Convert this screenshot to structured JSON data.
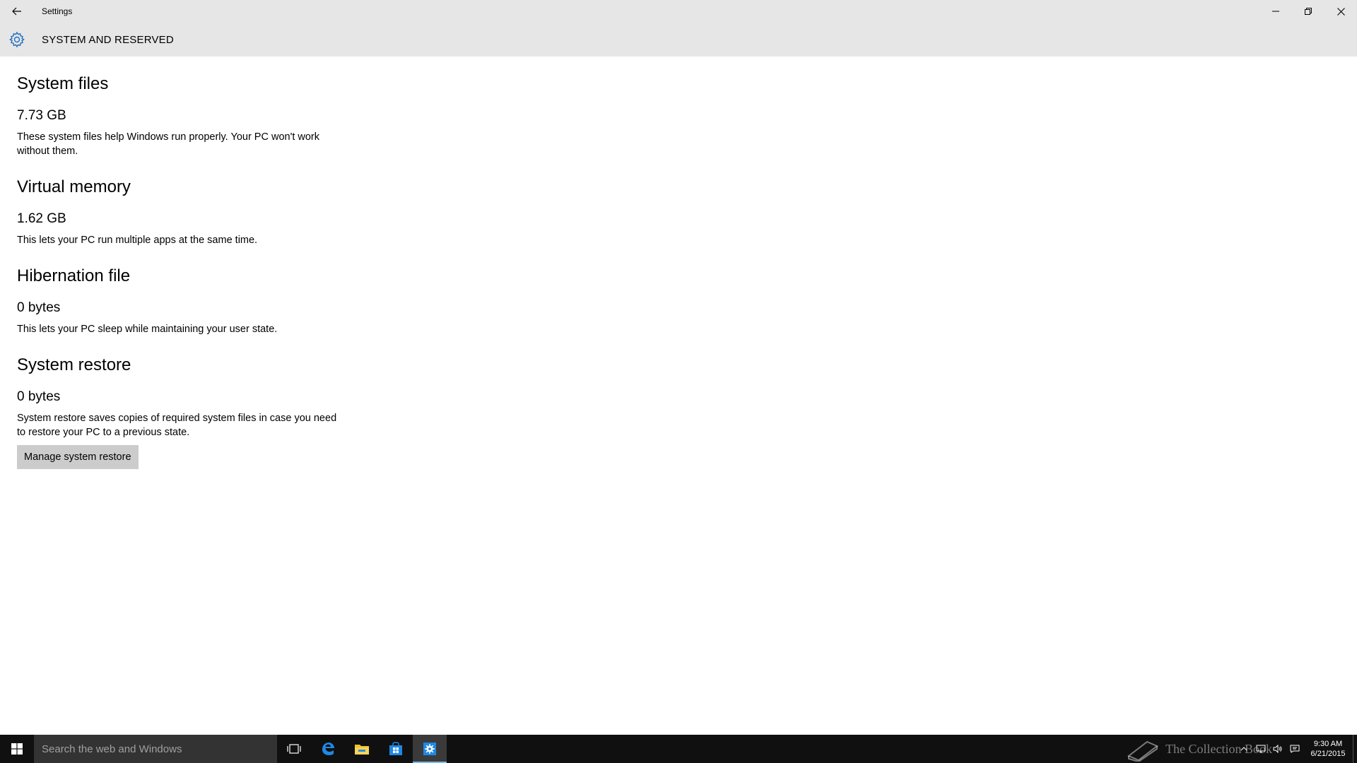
{
  "window": {
    "title": "Settings"
  },
  "header": {
    "title": "SYSTEM AND RESERVED"
  },
  "sections": [
    {
      "title": "System files",
      "size": "7.73 GB",
      "description": "These system files help Windows run properly. Your PC won't work without them."
    },
    {
      "title": "Virtual memory",
      "size": "1.62 GB",
      "description": "This lets your PC run multiple apps at the same time."
    },
    {
      "title": "Hibernation file",
      "size": "0 bytes",
      "description": "This lets your PC sleep while maintaining your user state."
    },
    {
      "title": "System restore",
      "size": "0 bytes",
      "description": "System restore saves copies of required system files in case you need to restore your PC to a previous state.",
      "button_label": "Manage system restore"
    }
  ],
  "taskbar": {
    "search_placeholder": "Search the web and Windows",
    "watermark": "The Collection Book",
    "time": "9:30 AM",
    "date": "6/21/2015",
    "accent_color": "#76b9ed"
  },
  "icons": {
    "back": "back-arrow-icon",
    "settings": "gear-icon",
    "minimize": "minimize-icon",
    "restore": "restore-icon",
    "close": "close-icon",
    "start": "windows-logo-icon",
    "task_view": "task-view-icon",
    "edge": "edge-icon",
    "explorer": "folder-icon",
    "store": "store-icon",
    "settings_app": "gear-icon"
  }
}
